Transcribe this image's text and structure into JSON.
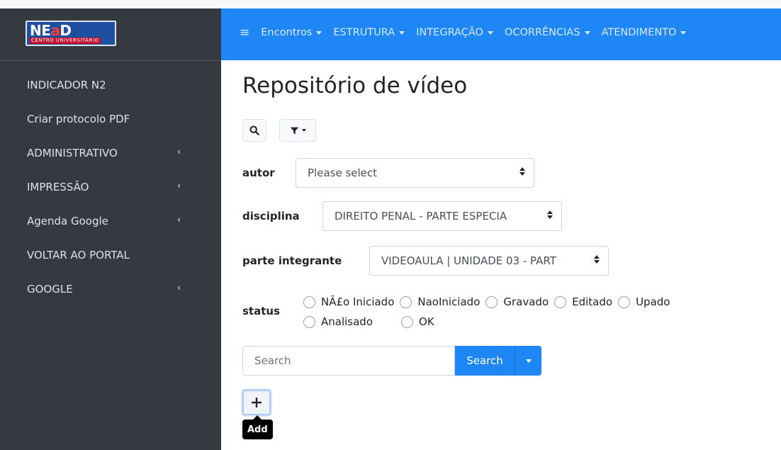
{
  "brand": {
    "logo_main_prefix": "NE",
    "logo_main_highlight": "a",
    "logo_main_suffix": "D",
    "logo_sub": "CENTRO UNIVERSITÁRIO"
  },
  "sidebar": {
    "items": [
      {
        "label": "INDICADOR N2",
        "has_chevron": false
      },
      {
        "label": "Criar protocolo PDF",
        "has_chevron": false
      },
      {
        "label": "ADMINISTRATIVO",
        "has_chevron": true
      },
      {
        "label": "IMPRESSÃO",
        "has_chevron": true
      },
      {
        "label": "Agenda Google",
        "has_chevron": true
      },
      {
        "label": "VOLTAR AO PORTAL",
        "has_chevron": false
      },
      {
        "label": "GOOGLE",
        "has_chevron": true
      }
    ],
    "chevron_glyph": "‹"
  },
  "topbar": {
    "toggle_icon": "≡",
    "menu": [
      {
        "label": "Encontros"
      },
      {
        "label": "ESTRUTURA"
      },
      {
        "label": "INTEGRAÇÃO"
      },
      {
        "label": "OCORRÊNCIAS"
      },
      {
        "label": "ATENDIMENTO"
      }
    ]
  },
  "page": {
    "title": "Repositório de vídeo"
  },
  "toolbar": {
    "search_icon": "search-icon",
    "filter_icon": "filter-icon"
  },
  "form": {
    "autor": {
      "label": "autor",
      "value": "Please select"
    },
    "disciplina": {
      "label": "disciplina",
      "value": "DIREITO PENAL - PARTE ESPECIA"
    },
    "parte": {
      "label": "parte integrante",
      "value": "VIDEOAULA | UNIDADE 03 - PART"
    },
    "status": {
      "label": "status",
      "options_row1": [
        "NÃ£o Iniciado",
        "NaoIniciado",
        "Gravado",
        "Editado",
        "Upado"
      ],
      "options_row2": [
        "Analisado",
        "OK"
      ]
    }
  },
  "search": {
    "placeholder": "Search",
    "button_label": "Search"
  },
  "add": {
    "icon": "+",
    "tooltip": "Add"
  },
  "colors": {
    "sidebar_bg": "#343a40",
    "topbar_bg": "#1e87f5",
    "primary": "#1e87f5"
  }
}
